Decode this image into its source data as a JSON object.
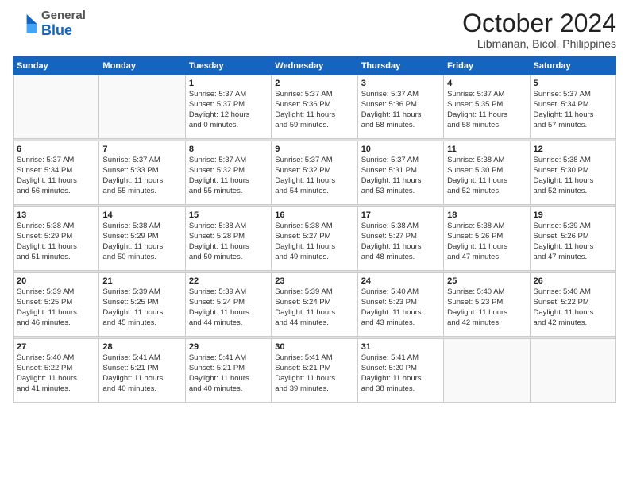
{
  "logo": {
    "general": "General",
    "blue": "Blue"
  },
  "title": "October 2024",
  "subtitle": "Libmanan, Bicol, Philippines",
  "days_header": [
    "Sunday",
    "Monday",
    "Tuesday",
    "Wednesday",
    "Thursday",
    "Friday",
    "Saturday"
  ],
  "weeks": [
    [
      {
        "day": "",
        "info": ""
      },
      {
        "day": "",
        "info": ""
      },
      {
        "day": "1",
        "info": "Sunrise: 5:37 AM\nSunset: 5:37 PM\nDaylight: 12 hours\nand 0 minutes."
      },
      {
        "day": "2",
        "info": "Sunrise: 5:37 AM\nSunset: 5:36 PM\nDaylight: 11 hours\nand 59 minutes."
      },
      {
        "day": "3",
        "info": "Sunrise: 5:37 AM\nSunset: 5:36 PM\nDaylight: 11 hours\nand 58 minutes."
      },
      {
        "day": "4",
        "info": "Sunrise: 5:37 AM\nSunset: 5:35 PM\nDaylight: 11 hours\nand 58 minutes."
      },
      {
        "day": "5",
        "info": "Sunrise: 5:37 AM\nSunset: 5:34 PM\nDaylight: 11 hours\nand 57 minutes."
      }
    ],
    [
      {
        "day": "6",
        "info": "Sunrise: 5:37 AM\nSunset: 5:34 PM\nDaylight: 11 hours\nand 56 minutes."
      },
      {
        "day": "7",
        "info": "Sunrise: 5:37 AM\nSunset: 5:33 PM\nDaylight: 11 hours\nand 55 minutes."
      },
      {
        "day": "8",
        "info": "Sunrise: 5:37 AM\nSunset: 5:32 PM\nDaylight: 11 hours\nand 55 minutes."
      },
      {
        "day": "9",
        "info": "Sunrise: 5:37 AM\nSunset: 5:32 PM\nDaylight: 11 hours\nand 54 minutes."
      },
      {
        "day": "10",
        "info": "Sunrise: 5:37 AM\nSunset: 5:31 PM\nDaylight: 11 hours\nand 53 minutes."
      },
      {
        "day": "11",
        "info": "Sunrise: 5:38 AM\nSunset: 5:30 PM\nDaylight: 11 hours\nand 52 minutes."
      },
      {
        "day": "12",
        "info": "Sunrise: 5:38 AM\nSunset: 5:30 PM\nDaylight: 11 hours\nand 52 minutes."
      }
    ],
    [
      {
        "day": "13",
        "info": "Sunrise: 5:38 AM\nSunset: 5:29 PM\nDaylight: 11 hours\nand 51 minutes."
      },
      {
        "day": "14",
        "info": "Sunrise: 5:38 AM\nSunset: 5:29 PM\nDaylight: 11 hours\nand 50 minutes."
      },
      {
        "day": "15",
        "info": "Sunrise: 5:38 AM\nSunset: 5:28 PM\nDaylight: 11 hours\nand 50 minutes."
      },
      {
        "day": "16",
        "info": "Sunrise: 5:38 AM\nSunset: 5:27 PM\nDaylight: 11 hours\nand 49 minutes."
      },
      {
        "day": "17",
        "info": "Sunrise: 5:38 AM\nSunset: 5:27 PM\nDaylight: 11 hours\nand 48 minutes."
      },
      {
        "day": "18",
        "info": "Sunrise: 5:38 AM\nSunset: 5:26 PM\nDaylight: 11 hours\nand 47 minutes."
      },
      {
        "day": "19",
        "info": "Sunrise: 5:39 AM\nSunset: 5:26 PM\nDaylight: 11 hours\nand 47 minutes."
      }
    ],
    [
      {
        "day": "20",
        "info": "Sunrise: 5:39 AM\nSunset: 5:25 PM\nDaylight: 11 hours\nand 46 minutes."
      },
      {
        "day": "21",
        "info": "Sunrise: 5:39 AM\nSunset: 5:25 PM\nDaylight: 11 hours\nand 45 minutes."
      },
      {
        "day": "22",
        "info": "Sunrise: 5:39 AM\nSunset: 5:24 PM\nDaylight: 11 hours\nand 44 minutes."
      },
      {
        "day": "23",
        "info": "Sunrise: 5:39 AM\nSunset: 5:24 PM\nDaylight: 11 hours\nand 44 minutes."
      },
      {
        "day": "24",
        "info": "Sunrise: 5:40 AM\nSunset: 5:23 PM\nDaylight: 11 hours\nand 43 minutes."
      },
      {
        "day": "25",
        "info": "Sunrise: 5:40 AM\nSunset: 5:23 PM\nDaylight: 11 hours\nand 42 minutes."
      },
      {
        "day": "26",
        "info": "Sunrise: 5:40 AM\nSunset: 5:22 PM\nDaylight: 11 hours\nand 42 minutes."
      }
    ],
    [
      {
        "day": "27",
        "info": "Sunrise: 5:40 AM\nSunset: 5:22 PM\nDaylight: 11 hours\nand 41 minutes."
      },
      {
        "day": "28",
        "info": "Sunrise: 5:41 AM\nSunset: 5:21 PM\nDaylight: 11 hours\nand 40 minutes."
      },
      {
        "day": "29",
        "info": "Sunrise: 5:41 AM\nSunset: 5:21 PM\nDaylight: 11 hours\nand 40 minutes."
      },
      {
        "day": "30",
        "info": "Sunrise: 5:41 AM\nSunset: 5:21 PM\nDaylight: 11 hours\nand 39 minutes."
      },
      {
        "day": "31",
        "info": "Sunrise: 5:41 AM\nSunset: 5:20 PM\nDaylight: 11 hours\nand 38 minutes."
      },
      {
        "day": "",
        "info": ""
      },
      {
        "day": "",
        "info": ""
      }
    ]
  ]
}
